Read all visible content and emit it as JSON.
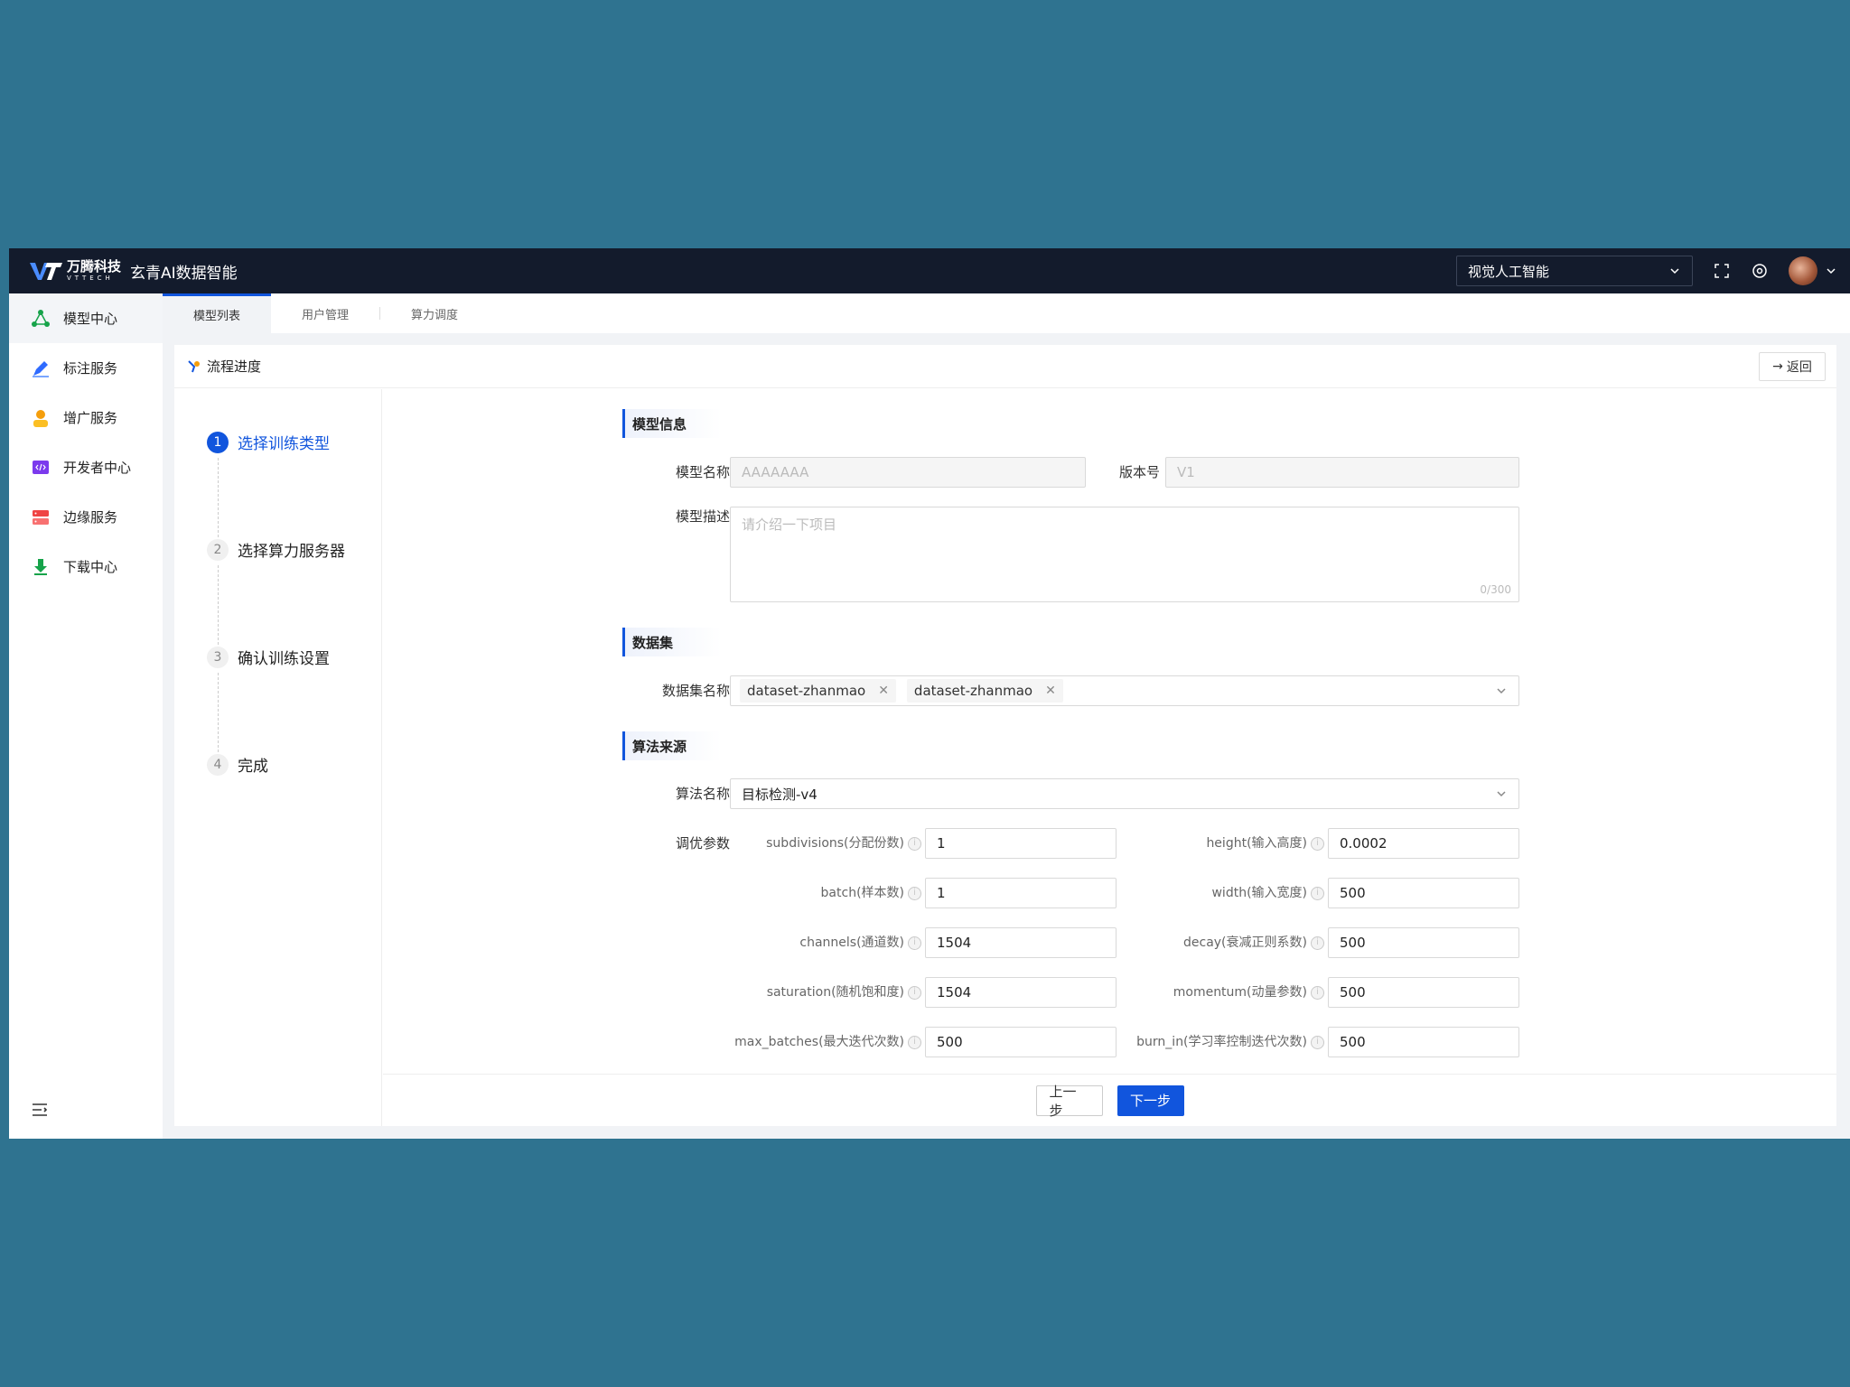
{
  "topbar": {
    "logo_cn": "万腾科技",
    "logo_en": "VTTECH",
    "title": "玄青AI数据智能",
    "workspace_select": "视觉人工智能"
  },
  "sidebar": {
    "items": [
      {
        "label": "模型中心",
        "icon": "model-network-icon",
        "color": "#17a34a"
      },
      {
        "label": "标注服务",
        "icon": "annotate-pen-icon",
        "color": "#2f6bff"
      },
      {
        "label": "增广服务",
        "icon": "person-icon",
        "color": "#f59e0b"
      },
      {
        "label": "开发者中心",
        "icon": "code-window-icon",
        "color": "#7c3aed"
      },
      {
        "label": "边缘服务",
        "icon": "server-icon",
        "color": "#ef4444"
      },
      {
        "label": "下载中心",
        "icon": "download-icon",
        "color": "#16a34a"
      }
    ]
  },
  "tabs": [
    {
      "label": "模型列表"
    },
    {
      "label": "用户管理"
    },
    {
      "label": "算力调度"
    }
  ],
  "card": {
    "title": "流程进度",
    "back_label": "返回"
  },
  "steps": [
    {
      "num": "1",
      "label": "选择训练类型"
    },
    {
      "num": "2",
      "label": "选择算力服务器"
    },
    {
      "num": "3",
      "label": "确认训练设置"
    },
    {
      "num": "4",
      "label": "完成"
    }
  ],
  "form": {
    "sections": {
      "model_info": "模型信息",
      "dataset": "数据集",
      "algorithm": "算法来源"
    },
    "model_name_label": "模型名称",
    "model_name_value": "AAAAAAA",
    "version_label": "版本号",
    "version_value": "V1",
    "desc_label": "模型描述",
    "desc_placeholder": "请介绍一下项目",
    "desc_counter": "0/300",
    "dataset_label": "数据集名称",
    "dataset_chips": [
      "dataset-zhanmao",
      "dataset-zhanmao"
    ],
    "algo_label": "算法名称",
    "algo_value": "目标检测-v4",
    "tuning_label": "调优参数",
    "params_left": [
      {
        "label": "subdivisions(分配份数)",
        "value": "1"
      },
      {
        "label": "batch(样本数)",
        "value": "1"
      },
      {
        "label": "channels(通道数)",
        "value": "1504"
      },
      {
        "label": "saturation(随机饱和度)",
        "value": "1504"
      },
      {
        "label": "max_batches(最大迭代次数)",
        "value": "500"
      }
    ],
    "params_right": [
      {
        "label": "height(输入高度)",
        "value": "0.0002"
      },
      {
        "label": "width(输入宽度)",
        "value": "500"
      },
      {
        "label": "decay(衰减正则系数)",
        "value": "500"
      },
      {
        "label": "momentum(动量参数)",
        "value": "500"
      },
      {
        "label": "burn_in(学习率控制迭代次数)",
        "value": "500"
      }
    ]
  },
  "footer": {
    "prev_label": "上一步",
    "next_label": "下一步"
  },
  "colors": {
    "primary": "#1155dd",
    "topbar": "#131b2c",
    "backdrop": "#2f7390"
  }
}
